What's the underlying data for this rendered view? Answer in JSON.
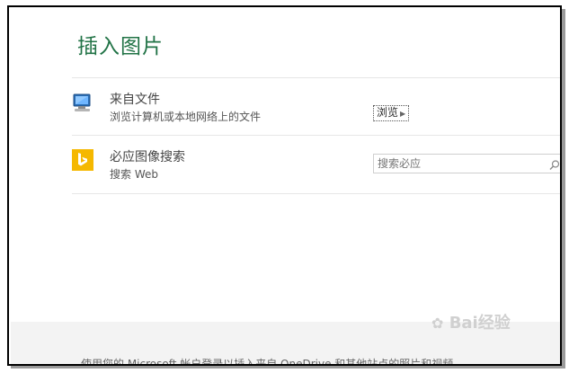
{
  "dialog": {
    "title": "插入图片"
  },
  "from_file": {
    "title": "来自文件",
    "subtitle": "浏览计算机或本地网络上的文件",
    "browse_label": "浏览",
    "icon": "computer-icon"
  },
  "bing": {
    "title": "必应图像搜索",
    "subtitle": "搜索 Web",
    "search_placeholder": "搜索必应",
    "icon": "bing-icon",
    "accent": "#f5b800"
  },
  "footer": {
    "text": "使用您的 Microsoft 帐户登录以插入来自 OneDrive 和其他站点的照片和视频。"
  },
  "watermark": {
    "text": "Bai经验"
  },
  "colors": {
    "title": "#217346"
  }
}
